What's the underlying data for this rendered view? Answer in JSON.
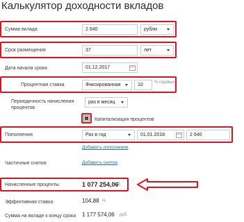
{
  "page": {
    "title": "Калькулятор доходности вкладов"
  },
  "deposit_amount": {
    "label": "Сумма вклада",
    "value": "2 640",
    "currency": "рубли"
  },
  "term": {
    "label": "Срок размещения",
    "value": "37",
    "unit": "лет"
  },
  "start_date": {
    "label": "Дата начала срока",
    "value": "01.12.2017"
  },
  "rate": {
    "label": "Процентная ставка",
    "type": "Фиксированная",
    "value": "10",
    "unit": "% годовых"
  },
  "accrual": {
    "label_line1": "Периодичность начисления",
    "label_line2": "процентов",
    "value": "раз в месяц"
  },
  "capitalization": {
    "label": "Капитализация процентов",
    "checked": true
  },
  "topups": {
    "label": "Пополнения",
    "frequency": "Раз в год",
    "date": "01.01.2018",
    "amount": "2 640",
    "add_link": "Добавить пополнение"
  },
  "withdrawals": {
    "label": "Частичные снятия",
    "add_link": "Добавить снятие"
  },
  "results": {
    "interest_label": "Начисленные проценты",
    "interest_value": "1 077 254,06",
    "interest_currency": "руб.",
    "effective_label": "Эффективная ставка",
    "effective_value": "104,88",
    "effective_unit": "%",
    "total_label": "Сумма на вкладе к концу срока",
    "total_value": "1 177 574,06",
    "total_currency": "руб."
  },
  "colors": {
    "highlight": "#d9141e",
    "link": "#1f6fb8"
  }
}
